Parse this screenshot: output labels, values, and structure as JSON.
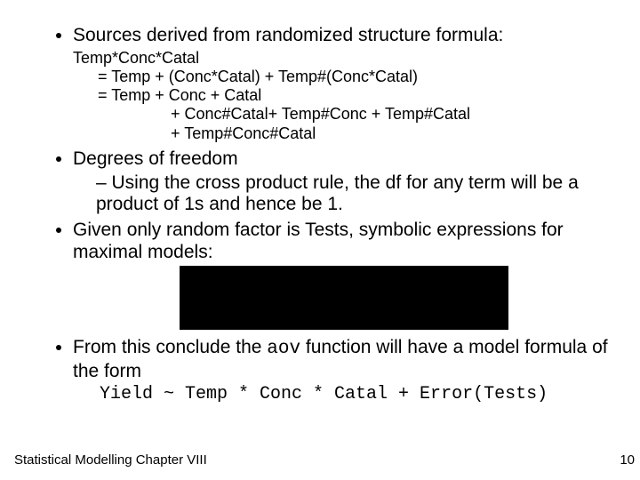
{
  "bullets": {
    "b1": "Sources derived from randomized structure formula:",
    "formula": {
      "l1": "Temp*Conc*Catal",
      "l2a": "= Temp + (Conc*Catal) + Temp#(Conc*Catal)",
      "l2b": "= Temp + Conc + Catal",
      "l3a": "+ Conc#Catal+ Temp#Conc + Temp#Catal",
      "l3b": "+ Temp#Conc#Catal"
    },
    "b2": "Degrees of freedom",
    "b2_sub": "Using the cross product rule, the df for any term will be a product of 1s and hence be 1.",
    "b3": "Given only random factor is Tests, symbolic expressions for maximal models:",
    "b4_pre": "From this conclude the ",
    "b4_mono": "aov",
    "b4_post": " function will have a model formula of the form",
    "model_formula": "Yield ~ Temp * Conc * Catal + Error(Tests)"
  },
  "footer": {
    "left": "Statistical Modelling   Chapter VIII",
    "right": "10"
  }
}
